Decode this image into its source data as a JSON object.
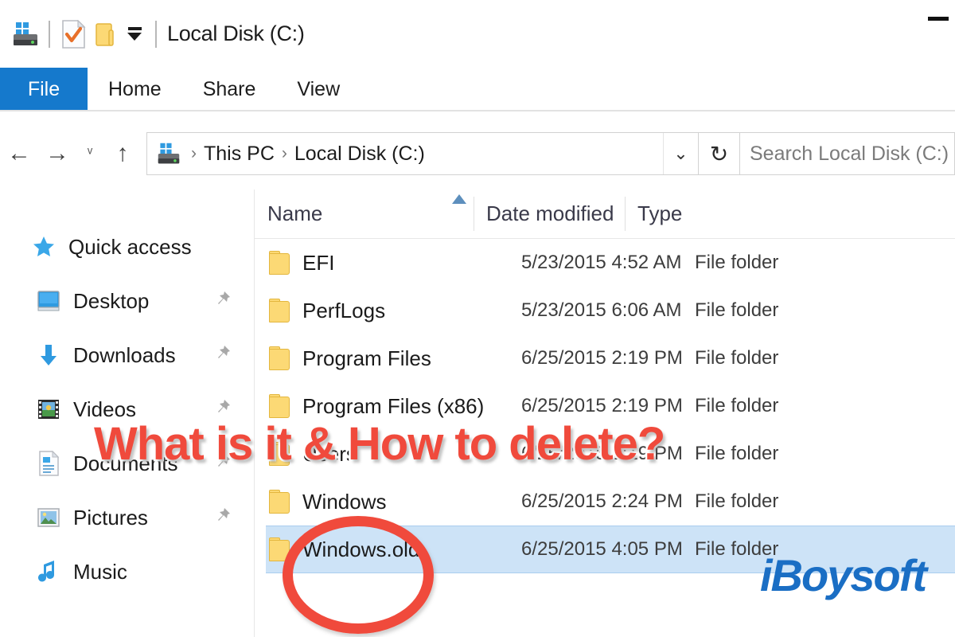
{
  "window": {
    "title": "Local Disk (C:)",
    "quick_access_toolbar": [
      {
        "name": "drive-icon",
        "label": "Local Disk"
      },
      {
        "name": "properties-icon",
        "label": "Properties"
      },
      {
        "name": "new-folder-icon",
        "label": "New folder"
      },
      {
        "name": "customize-qat-icon",
        "label": "Customize Quick Access Toolbar"
      }
    ],
    "minimize_label": "Minimize"
  },
  "ribbon": {
    "tabs": [
      {
        "label": "File",
        "active": true
      },
      {
        "label": "Home",
        "active": false
      },
      {
        "label": "Share",
        "active": false
      },
      {
        "label": "View",
        "active": false
      }
    ],
    "accent_color": "#1579cc"
  },
  "nav": {
    "back_glyph": "←",
    "forward_glyph": "→",
    "recent_glyph": "ᵛ",
    "up_glyph": "↑",
    "breadcrumbs": [
      "This PC",
      "Local Disk (C:)"
    ],
    "separator": "›",
    "chevron_glyph": "⌄",
    "refresh_glyph": "↻"
  },
  "search": {
    "placeholder": "Search Local Disk (C:)",
    "value": ""
  },
  "sidebar": {
    "items": [
      {
        "label": "Quick access",
        "icon": "star-icon",
        "pinned": false,
        "root": true
      },
      {
        "label": "Desktop",
        "icon": "desktop-icon",
        "pinned": true,
        "root": false
      },
      {
        "label": "Downloads",
        "icon": "download-arrow-icon",
        "pinned": true,
        "root": false
      },
      {
        "label": "Videos",
        "icon": "videos-icon",
        "pinned": true,
        "root": false
      },
      {
        "label": "Documents",
        "icon": "documents-icon",
        "pinned": true,
        "root": false
      },
      {
        "label": "Pictures",
        "icon": "pictures-icon",
        "pinned": true,
        "root": false
      },
      {
        "label": "Music",
        "icon": "music-note-icon",
        "pinned": false,
        "root": false
      }
    ],
    "pin_glyph": "📌"
  },
  "filelist": {
    "columns": [
      {
        "key": "name",
        "label": "Name",
        "sorted": "asc"
      },
      {
        "key": "date",
        "label": "Date modified",
        "sorted": null
      },
      {
        "key": "type",
        "label": "Type",
        "sorted": null
      }
    ],
    "rows": [
      {
        "name": "EFI",
        "date": "5/23/2015 4:52 AM",
        "type": "File folder",
        "selected": false
      },
      {
        "name": "PerfLogs",
        "date": "5/23/2015 6:06 AM",
        "type": "File folder",
        "selected": false
      },
      {
        "name": "Program Files",
        "date": "6/25/2015 2:19 PM",
        "type": "File folder",
        "selected": false
      },
      {
        "name": "Program Files (x86)",
        "date": "6/25/2015 2:19 PM",
        "type": "File folder",
        "selected": false
      },
      {
        "name": "Users",
        "date": "6/25/2015 2:19 PM",
        "type": "File folder",
        "selected": false
      },
      {
        "name": "Windows",
        "date": "6/25/2015 2:24 PM",
        "type": "File folder",
        "selected": false
      },
      {
        "name": "Windows.old",
        "date": "6/25/2015 4:05 PM",
        "type": "File folder",
        "selected": true
      }
    ],
    "selection_color": "#cde3f7"
  },
  "annotations": {
    "headline": "What is it & How to delete?",
    "headline_color": "#f04a3c",
    "circle_target": "Windows.old",
    "circle_color": "#f04a3c",
    "watermark": "iBoysoft",
    "watermark_color": "#1a6ec4"
  }
}
